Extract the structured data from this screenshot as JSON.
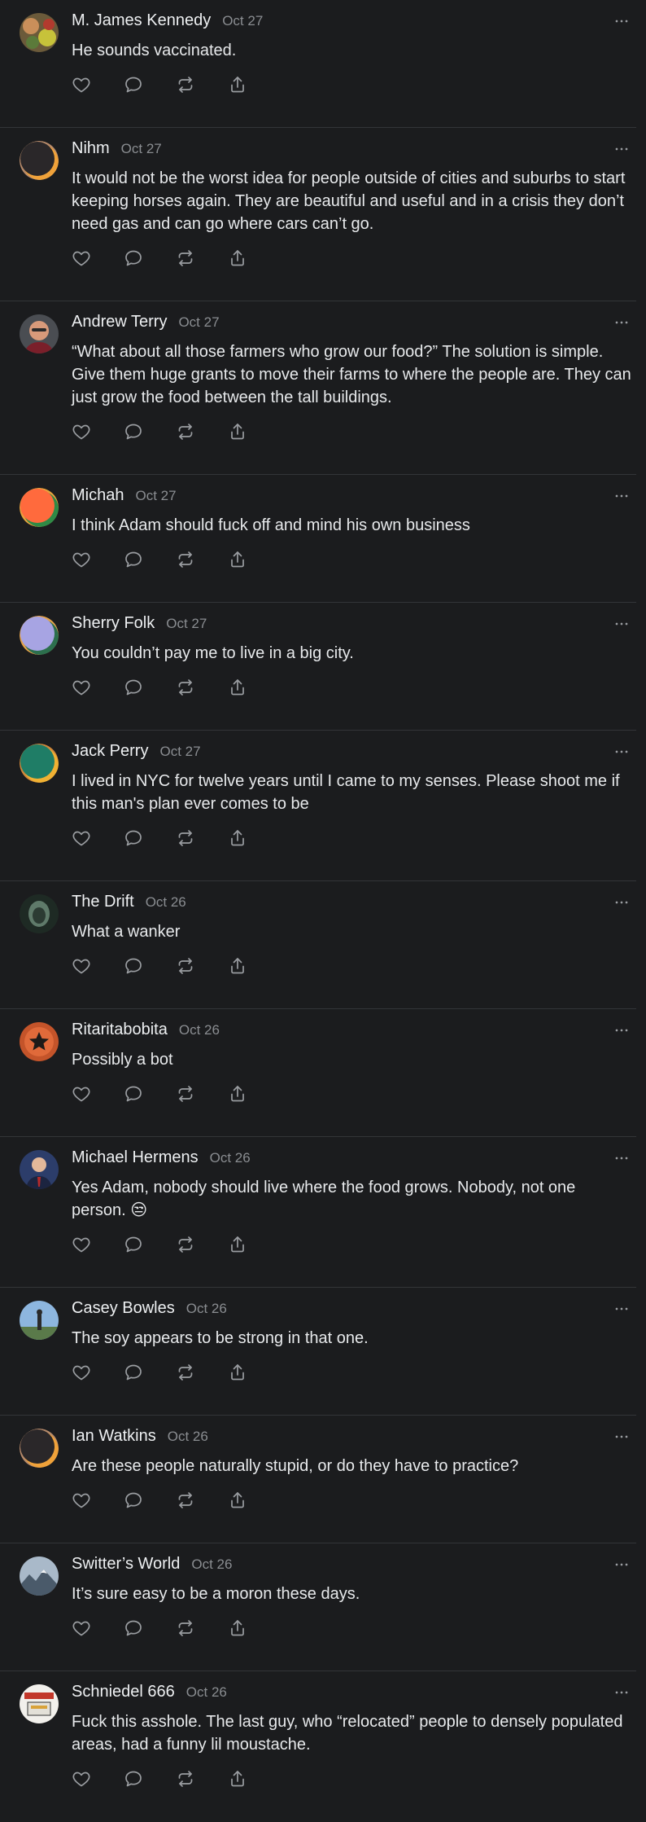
{
  "colors": {
    "background": "#1b1c1e",
    "divider": "#333538",
    "icon": "#9a9da1",
    "date": "#8a8d91"
  },
  "action_icons": [
    "heart-icon",
    "comment-icon",
    "repost-icon",
    "share-icon"
  ],
  "comments": [
    {
      "author": "M. James Kennedy",
      "date": "Oct 27",
      "text": "He sounds vaccinated.",
      "lines": 1,
      "avatar": "photo-mixed"
    },
    {
      "author": "Nihm",
      "date": "Oct 27",
      "text": "It would not be the worst idea for people outside of cities and suburbs to start keeping horses again. They are beautiful and useful and in a crisis they don’t need gas and can go where cars can’t go.",
      "lines": 3,
      "avatar": "ring-dark"
    },
    {
      "author": "Andrew Terry",
      "date": "Oct 27",
      "text": "“What about all those farmers who grow our food?” The solution is simple. Give them huge grants to move their farms to where the people are. They can just grow the food between the tall buildings.",
      "lines": 3,
      "avatar": "photo-face"
    },
    {
      "author": "Michah",
      "date": "Oct 27",
      "text": "I think Adam should fuck off and mind his own business",
      "lines": 1,
      "avatar": "ring-orange"
    },
    {
      "author": "Sherry Folk",
      "date": "Oct 27",
      "text": "You couldn’t pay me to live in a big city.",
      "lines": 1,
      "avatar": "ring-lavender"
    },
    {
      "author": "Jack Perry",
      "date": "Oct 27",
      "text": "I lived in NYC for twelve years until I came to my senses. Please shoot me if this man's plan ever comes to be",
      "lines": 2,
      "avatar": "ring-teal"
    },
    {
      "author": "The Drift",
      "date": "Oct 26",
      "text": "What a wanker",
      "lines": 1,
      "avatar": "photo-dark"
    },
    {
      "author": "Ritaritabobita",
      "date": "Oct 26",
      "text": "Possibly a bot",
      "lines": 1,
      "avatar": "photo-star"
    },
    {
      "author": "Michael Hermens",
      "date": "Oct 26",
      "text": "Yes Adam, nobody should live where the food grows. Nobody, not one person. 😒",
      "lines": 2,
      "avatar": "photo-suit"
    },
    {
      "author": "Casey Bowles",
      "date": "Oct 26",
      "text": "The soy appears to be strong in that one.",
      "lines": 1,
      "avatar": "photo-sky"
    },
    {
      "author": "Ian Watkins",
      "date": "Oct 26",
      "text": "Are these people naturally stupid, or do they have to practice?",
      "lines": 1,
      "avatar": "ring-dark"
    },
    {
      "author": "Switter’s World",
      "date": "Oct 26",
      "text": "It’s sure easy to be a moron these days.",
      "lines": 1,
      "avatar": "photo-mountain"
    },
    {
      "author": "Schniedel 666",
      "date": "Oct 26",
      "text": "Fuck this asshole. The last guy, who “relocated” people to densely populated areas, had a funny lil moustache.",
      "lines": 2,
      "avatar": "photo-flag"
    }
  ]
}
